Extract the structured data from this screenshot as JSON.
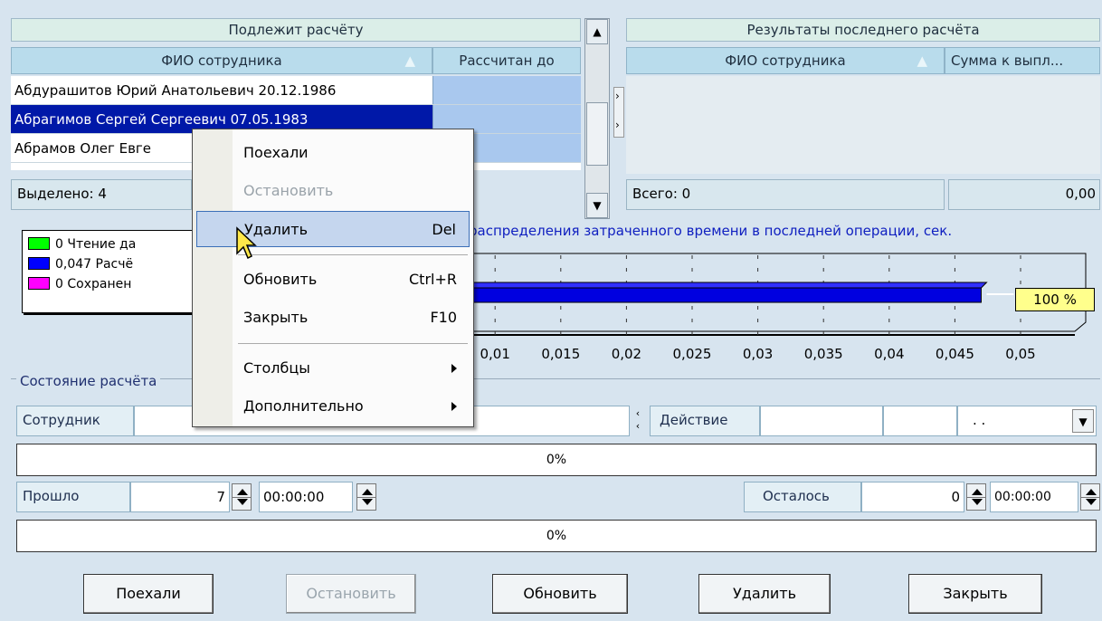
{
  "left_grid": {
    "title": "Подлежит расчёту",
    "col_name": "ФИО сотрудника",
    "col_date": "Рассчитан до",
    "rows": [
      {
        "name": "Абдурашитов Юрий Анатольевич 20.12.1986"
      },
      {
        "name": "Абрагимов Сергей Сергеевич 07.05.1983"
      },
      {
        "name": "Абрамов Олег Евге"
      }
    ],
    "selected_label": "Выделено: 4"
  },
  "right_grid": {
    "title": "Результаты последнего расчёта",
    "col_name": "ФИО сотрудника",
    "col_sum": "Сумма к выпл...",
    "total_label": "Всего: 0",
    "total_value": "0,00"
  },
  "chart": {
    "title": "распределения затраченного времени в последней операции, сек.",
    "legend": [
      {
        "label": "0 Чтение да",
        "color": "#00ff00"
      },
      {
        "label": "0,047 Расчё",
        "color": "#0000ff"
      },
      {
        "label": "0 Сохранен",
        "color": "#ff00ff"
      }
    ],
    "percent_label": "100 %"
  },
  "chart_data": {
    "type": "bar",
    "orientation": "horizontal",
    "categories": [
      "Чтение да",
      "Расчё",
      "Сохранен"
    ],
    "values": [
      0,
      0.047,
      0
    ],
    "tick_labels": [
      "0,01",
      "0,015",
      "0,02",
      "0,025",
      "0,03",
      "0,035",
      "0,04",
      "0,045",
      "0,05"
    ],
    "xlim": [
      0,
      0.05
    ]
  },
  "state": {
    "group_label": "Состояние расчёта",
    "employee_label": "Сотрудник",
    "action_label": "Действие",
    "action_select": ". .",
    "progress1": "0%",
    "progress2": "0%",
    "elapsed_label": "Прошло",
    "elapsed_count": "7",
    "elapsed_time": "00:00:00",
    "remaining_label": "Осталось",
    "remaining_count": "0",
    "remaining_time": "00:00:00"
  },
  "buttons": {
    "go": "Поехали",
    "stop": "Остановить",
    "refresh": "Обновить",
    "delete": "Удалить",
    "close": "Закрыть"
  },
  "context_menu": {
    "items": [
      {
        "label": "Поехали",
        "shortcut": ""
      },
      {
        "label": "Остановить",
        "shortcut": ""
      },
      {
        "label": "Удалить",
        "shortcut": "Del"
      },
      {
        "label": "Обновить",
        "shortcut": "Ctrl+R"
      },
      {
        "label": "Закрыть",
        "shortcut": "F10"
      },
      {
        "label": "Столбцы",
        "shortcut": ""
      },
      {
        "label": "Дополнительно",
        "shortcut": ""
      }
    ]
  }
}
